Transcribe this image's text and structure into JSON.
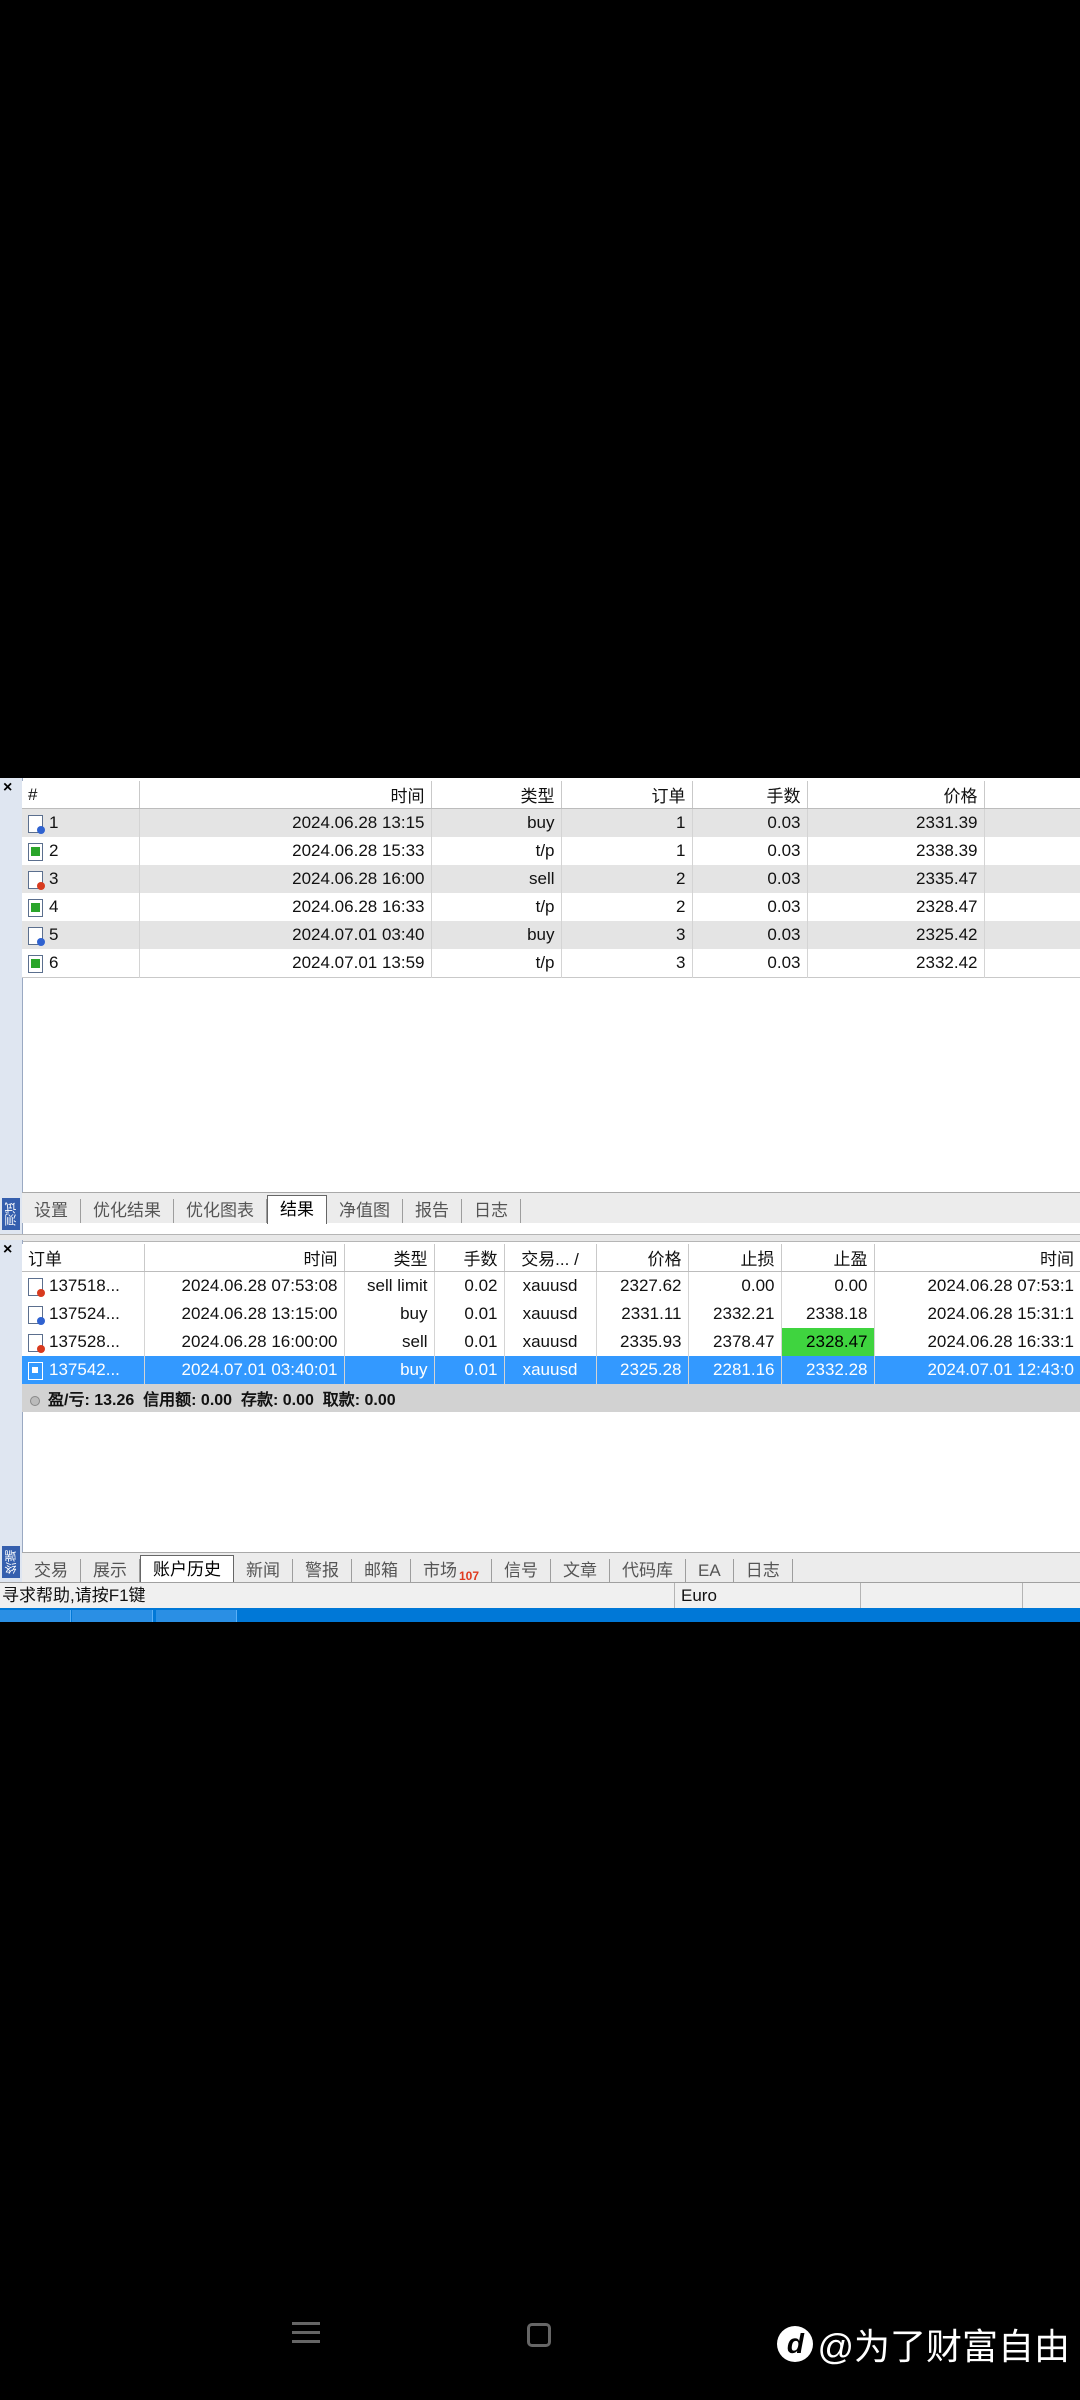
{
  "tester": {
    "side_label": "测试",
    "columns": [
      "#",
      "时间",
      "类型",
      "订单",
      "手数",
      "价格"
    ],
    "rows": [
      {
        "num": "1",
        "time": "2024.06.28 13:15",
        "type": "buy",
        "order": "1",
        "lots": "0.03",
        "price": "2331.39"
      },
      {
        "num": "2",
        "time": "2024.06.28 15:33",
        "type": "t/p",
        "order": "1",
        "lots": "0.03",
        "price": "2338.39"
      },
      {
        "num": "3",
        "time": "2024.06.28 16:00",
        "type": "sell",
        "order": "2",
        "lots": "0.03",
        "price": "2335.47"
      },
      {
        "num": "4",
        "time": "2024.06.28 16:33",
        "type": "t/p",
        "order": "2",
        "lots": "0.03",
        "price": "2328.47"
      },
      {
        "num": "5",
        "time": "2024.07.01 03:40",
        "type": "buy",
        "order": "3",
        "lots": "0.03",
        "price": "2325.42"
      },
      {
        "num": "6",
        "time": "2024.07.01 13:59",
        "type": "t/p",
        "order": "3",
        "lots": "0.03",
        "price": "2332.42"
      }
    ],
    "tabs": [
      "设置",
      "优化结果",
      "优化图表",
      "结果",
      "净值图",
      "报告",
      "日志"
    ],
    "active_tab": "结果"
  },
  "terminal": {
    "side_label": "终端",
    "columns": [
      "订单",
      "时间",
      "类型",
      "手数",
      "交易... /",
      "价格",
      "止损",
      "止盈",
      "时间"
    ],
    "rows": [
      {
        "order": "137518...",
        "time": "2024.06.28 07:53:08",
        "type": "sell limit",
        "lots": "0.02",
        "symbol": "xauusd",
        "price": "2327.62",
        "sl": "0.00",
        "tp": "0.00",
        "close_time": "2024.06.28 07:53:1"
      },
      {
        "order": "137524...",
        "time": "2024.06.28 13:15:00",
        "type": "buy",
        "lots": "0.01",
        "symbol": "xauusd",
        "price": "2331.11",
        "sl": "2332.21",
        "tp": "2338.18",
        "close_time": "2024.06.28 15:31:1"
      },
      {
        "order": "137528...",
        "time": "2024.06.28 16:00:00",
        "type": "sell",
        "lots": "0.01",
        "symbol": "xauusd",
        "price": "2335.93",
        "sl": "2378.47",
        "tp": "2328.47",
        "close_time": "2024.06.28 16:33:1"
      },
      {
        "order": "137542...",
        "time": "2024.07.01 03:40:01",
        "type": "buy",
        "lots": "0.01",
        "symbol": "xauusd",
        "price": "2325.28",
        "sl": "2281.16",
        "tp": "2332.28",
        "close_time": "2024.07.01 12:43:0"
      }
    ],
    "summary": "盈/亏: 13.26  信用额: 0.00  存款: 0.00  取款: 0.00",
    "tabs": [
      "交易",
      "展示",
      "账户历史",
      "新闻",
      "警报",
      "邮箱",
      "市场",
      "信号",
      "文章",
      "代码库",
      "EA",
      "日志"
    ],
    "market_badge": "107",
    "active_tab": "账户历史"
  },
  "statusbar": {
    "help": "寻求帮助,请按F1键",
    "profile": "Euro"
  },
  "watermark": {
    "text": "@为了财富自由"
  },
  "colors": {
    "selection": "#3399ff",
    "tp_highlight": "#3fd43f",
    "tab_badge": "#e03a1e"
  }
}
